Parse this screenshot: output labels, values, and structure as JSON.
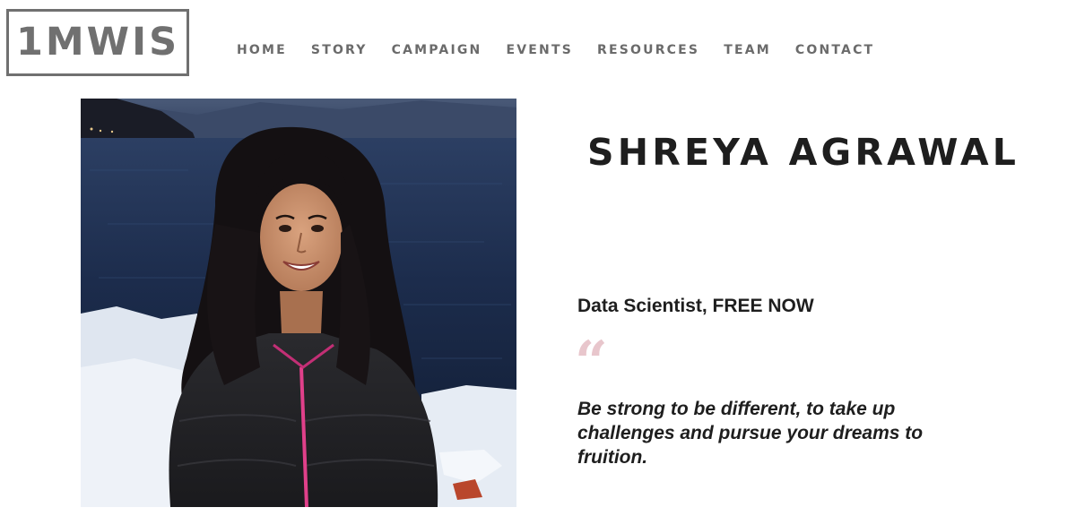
{
  "header": {
    "logo_text": "1MWIS",
    "nav": [
      {
        "label": "HOME"
      },
      {
        "label": "STORY"
      },
      {
        "label": "CAMPAIGN"
      },
      {
        "label": "EVENTS"
      },
      {
        "label": "RESOURCES"
      },
      {
        "label": "TEAM"
      },
      {
        "label": "CONTACT"
      }
    ]
  },
  "profile": {
    "name": "SHREYA AGRAWAL",
    "role": "Data Scientist, FREE NOW",
    "quote_mark": "“",
    "quote": "Be strong to be different, to take up challenges and pursue your dreams to fruition."
  },
  "colors": {
    "logo_gray": "#707070",
    "nav_gray": "#6b6b6b",
    "text_dark": "#1e1e1e",
    "quote_pink": "#e8c6cc"
  }
}
